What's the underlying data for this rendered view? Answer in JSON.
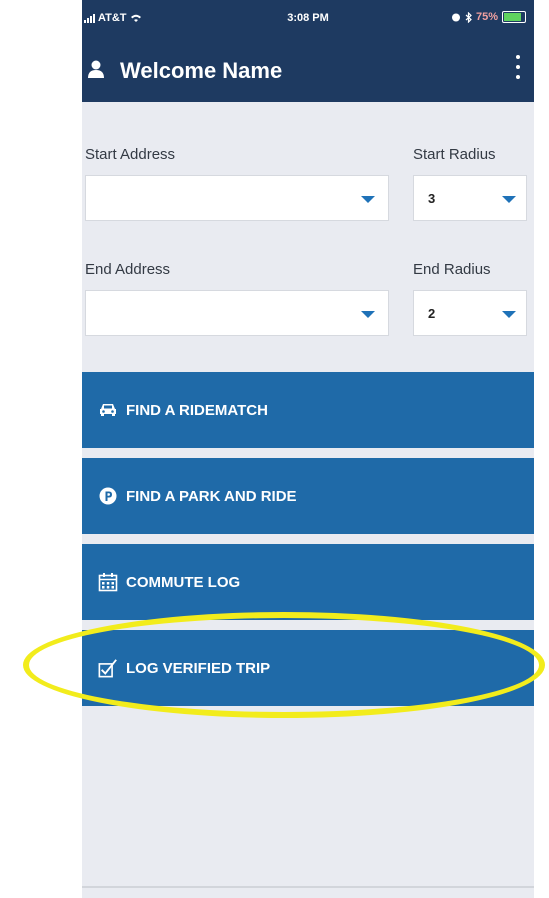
{
  "status_bar": {
    "carrier": "AT&T",
    "time": "3:08 PM",
    "battery": "75%",
    "battery_level": 0.75
  },
  "header": {
    "title": "Welcome Name",
    "user_icon": "user-icon",
    "menu_icon": "kebab-menu-icon"
  },
  "form": {
    "start_address_label": "Start Address",
    "start_address_value": "",
    "start_radius_label": "Start Radius",
    "start_radius_value": "3",
    "end_address_label": "End Address",
    "end_address_value": "",
    "end_radius_label": "End Radius",
    "end_radius_value": "2"
  },
  "actions": [
    {
      "label": "FIND A RIDEMATCH",
      "icon": "car-icon"
    },
    {
      "label": "FIND A PARK AND RIDE",
      "icon": "parking-icon"
    },
    {
      "label": "COMMUTE LOG",
      "icon": "calendar-icon"
    },
    {
      "label": "LOG VERIFIED TRIP",
      "icon": "checkbox-icon"
    }
  ],
  "colors": {
    "header": "#1e3a61",
    "button": "#1f6aa8",
    "highlight": "#f2ec1c",
    "background": "#e9ebf1"
  }
}
